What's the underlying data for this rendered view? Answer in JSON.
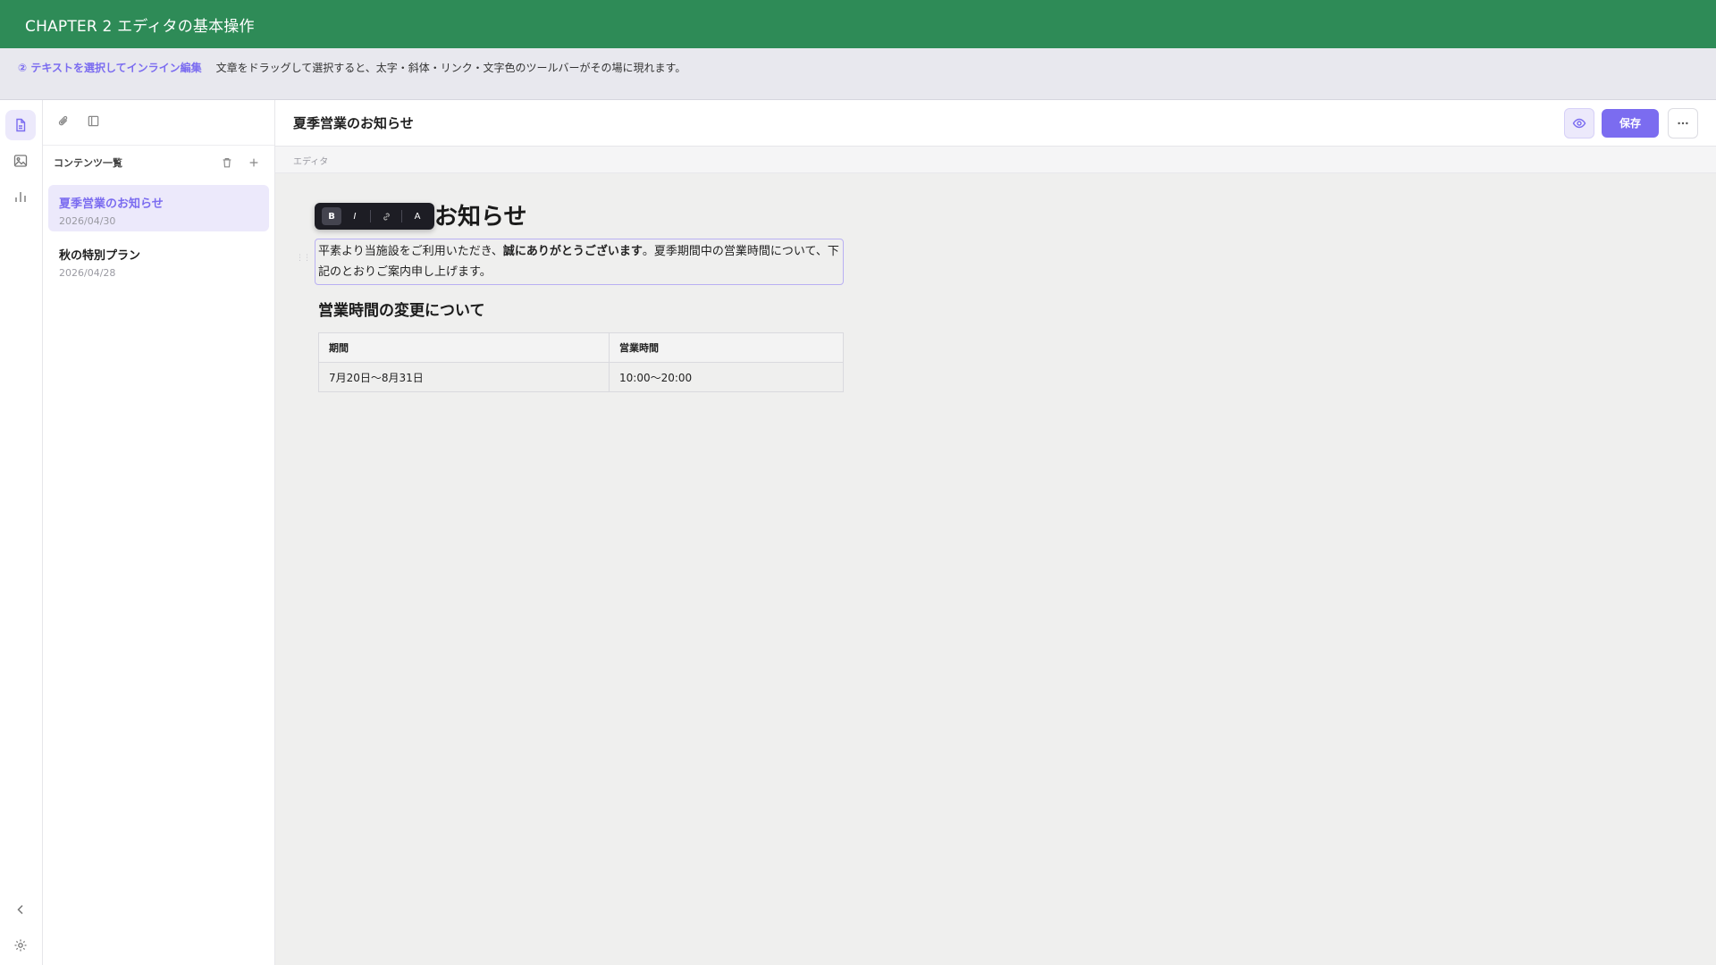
{
  "chapter": {
    "title": "CHAPTER 2 エディタの基本操作"
  },
  "instruction": {
    "step": "② テキストを選択してインライン編集",
    "description": "文章をドラッグして選択すると、太字・斜体・リンク・文字色のツールバーがその場に現れます。"
  },
  "rail": {
    "items": [
      {
        "icon": "document-icon",
        "active": true
      },
      {
        "icon": "image-icon",
        "active": false
      },
      {
        "icon": "bar-chart-icon",
        "active": false
      }
    ],
    "bottom": [
      {
        "icon": "chevron-left-icon"
      },
      {
        "icon": "gear-icon"
      }
    ]
  },
  "list": {
    "header": "コンテンツ一覧",
    "items": [
      {
        "title": "夏季営業のお知らせ",
        "date": "2026/04/30",
        "active": true
      },
      {
        "title": "秋の特別プラン",
        "date": "2026/04/28",
        "active": false
      }
    ]
  },
  "editor": {
    "title": "夏季営業のお知らせ",
    "save_label": "保存",
    "section_label": "エディタ",
    "heading1": "夏季営業のお知らせ",
    "para_before": "平素より当施設をご利用いただき、",
    "para_bold": "誠にありがとうございます",
    "para_after": "。夏季期間中の営業時間について、下記のとおりご案内申し上げます。",
    "heading2": "営業時間の変更について",
    "table": {
      "headers": [
        "期間",
        "営業時間"
      ],
      "rows": [
        [
          "7月20日〜8月31日",
          "10:00〜20:00"
        ]
      ]
    }
  },
  "inline_toolbar": {
    "bold": "B",
    "italic": "I",
    "color": "A"
  },
  "colors": {
    "accent": "#7b6cf0",
    "chapter_bar": "#2e8b57"
  }
}
